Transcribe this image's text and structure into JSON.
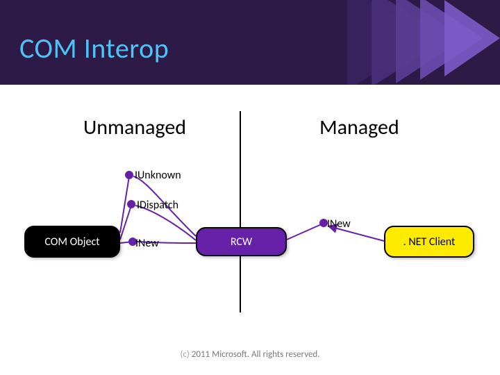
{
  "title": "COM Interop",
  "headings": {
    "left": "Unmanaged",
    "right": "Managed"
  },
  "boxes": {
    "com_object": "COM Object",
    "rcw": "RCW",
    "net_client": ". NET Client"
  },
  "interfaces": {
    "iunknown": "IUnknown",
    "idispatch": "IDispatch",
    "inew_left": "INew",
    "inew_right": "INew"
  },
  "footer": {
    "copyright": "(c)",
    "text": " 2011 Microsoft. All rights reserved."
  },
  "colors": {
    "header_bg": "#2e1a47",
    "title_color": "#4fc3f7",
    "rcw_fill": "#6621a8",
    "netclient_fill": "#ffeb00",
    "wire": "#6621a8",
    "dot": "#6621a8"
  },
  "chart_data": {
    "type": "diagram",
    "title": "COM Interop",
    "regions": [
      {
        "name": "Unmanaged",
        "side": "left"
      },
      {
        "name": "Managed",
        "side": "right"
      }
    ],
    "nodes": [
      {
        "id": "com_object",
        "label": "COM Object",
        "region": "Unmanaged"
      },
      {
        "id": "rcw",
        "label": "RCW",
        "region": "boundary"
      },
      {
        "id": "net_client",
        "label": ". NET Client",
        "region": "Managed"
      }
    ],
    "interfaces_exposed": [
      {
        "from": "com_object",
        "name": "IUnknown"
      },
      {
        "from": "com_object",
        "name": "IDispatch"
      },
      {
        "from": "com_object",
        "name": "INew"
      }
    ],
    "consumed_by_rcw": [
      "IUnknown",
      "IDispatch",
      "INew"
    ],
    "edges": [
      {
        "from": "com_object",
        "to": "rcw",
        "via": [
          "IUnknown",
          "IDispatch",
          "INew"
        ]
      },
      {
        "from": "rcw",
        "to": "net_client",
        "via": [
          "INew"
        ]
      }
    ]
  }
}
